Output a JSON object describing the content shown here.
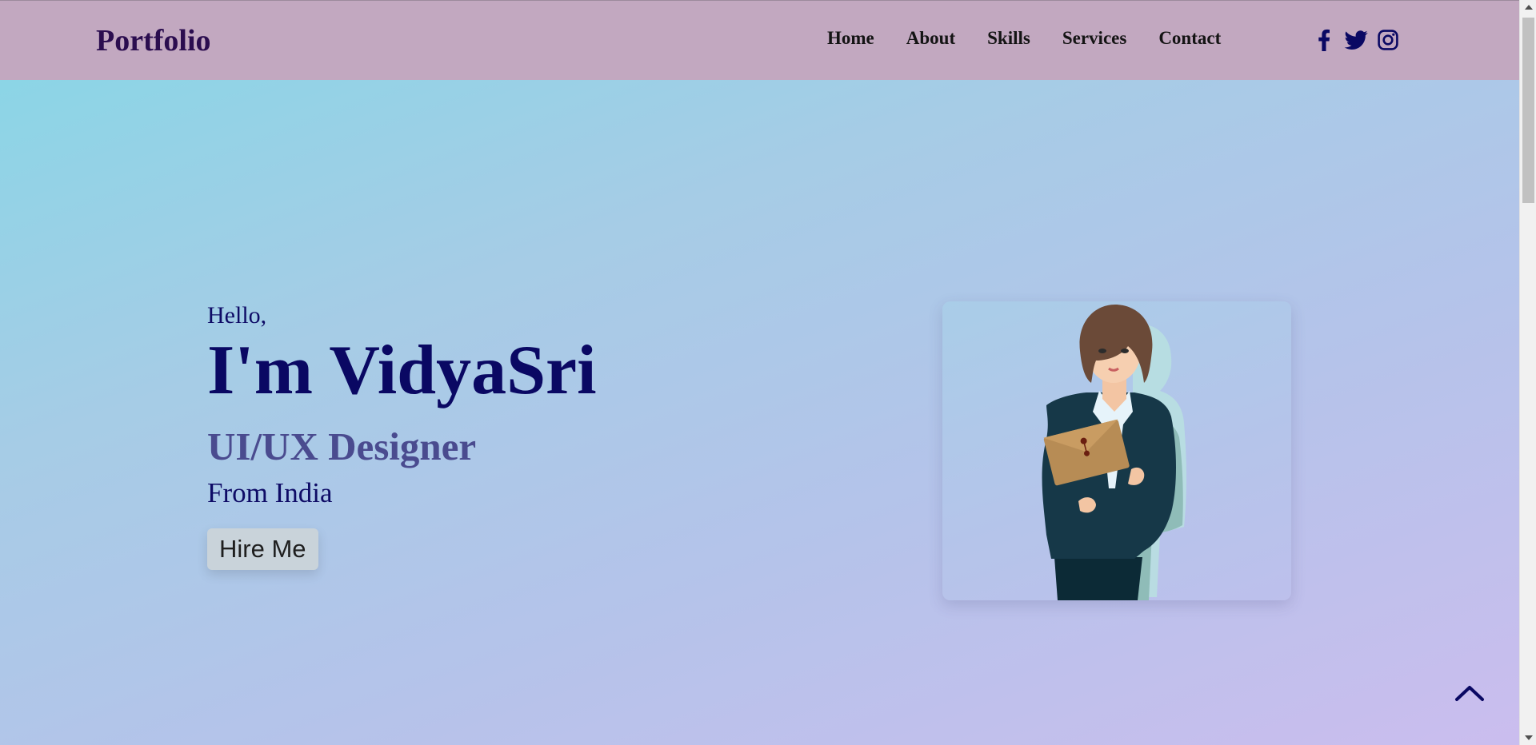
{
  "header": {
    "logo": "Portfolio",
    "nav": [
      "Home",
      "About",
      "Skills",
      "Services",
      "Contact"
    ],
    "socials": [
      "facebook-icon",
      "twitter-icon",
      "instagram-icon"
    ]
  },
  "hero": {
    "greeting": "Hello,",
    "name": "I'm VidyaSri",
    "role": "UI/UX Designer",
    "origin": "From India",
    "cta": "Hire Me"
  },
  "colors": {
    "navbar": "#c2a8c0",
    "heading": "#0a0863",
    "role": "#4a4b8f",
    "button": "#c9d3da"
  },
  "icons": {
    "scroll_top": "chevron-up-icon"
  }
}
